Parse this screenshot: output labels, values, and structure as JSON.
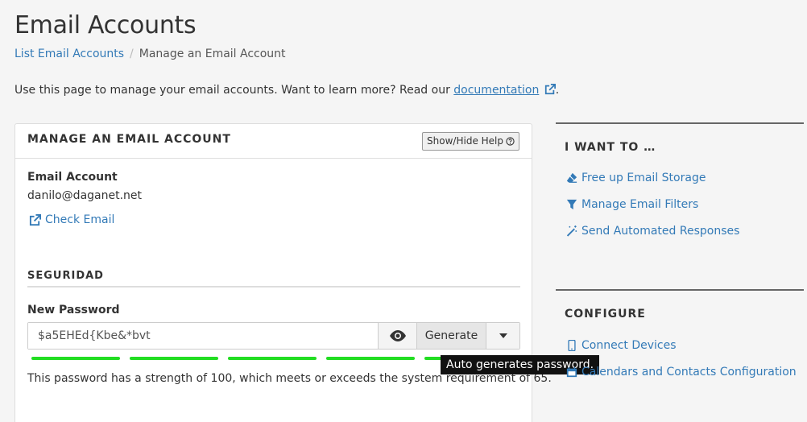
{
  "page": {
    "title": "Email Accounts",
    "breadcrumb": {
      "parent": "List Email Accounts",
      "separator": "/",
      "current": "Manage an Email Account"
    },
    "intro": {
      "text": "Use this page to manage your email accounts. Want to learn more? Read our ",
      "link": "documentation",
      "suffix": "."
    }
  },
  "panel": {
    "title": "MANAGE AN EMAIL ACCOUNT",
    "help_button": "Show/Hide Help",
    "account_label": "Email Account",
    "account_value": "danilo@daganet.net",
    "check_email": "Check Email",
    "security_heading": "SEGURIDAD",
    "password_label": "New Password",
    "password_value": "$a5EHEd{Kbe&*bvt",
    "generate_label": "Generate",
    "strength_text": "This password has a strength of 100, which meets or exceeds the system requirement of 65.",
    "strength_level": 1.0
  },
  "tooltip": "Auto generates password.",
  "sidebar": {
    "i_want_to": {
      "heading": "I WANT TO …",
      "items": [
        {
          "label": "Free up Email Storage",
          "icon": "eraser-icon"
        },
        {
          "label": "Manage Email Filters",
          "icon": "filter-icon"
        },
        {
          "label": "Send Automated Responses",
          "icon": "magic-wand-icon"
        }
      ]
    },
    "configure": {
      "heading": "CONFIGURE",
      "items": [
        {
          "label": "Connect Devices",
          "icon": "mobile-icon"
        },
        {
          "label": "Calendars and Contacts Configuration",
          "icon": "calendar-icon"
        }
      ]
    }
  },
  "colors": {
    "link": "#337ab7",
    "strength": "#22dd22",
    "tooltip_bg": "#111111"
  }
}
